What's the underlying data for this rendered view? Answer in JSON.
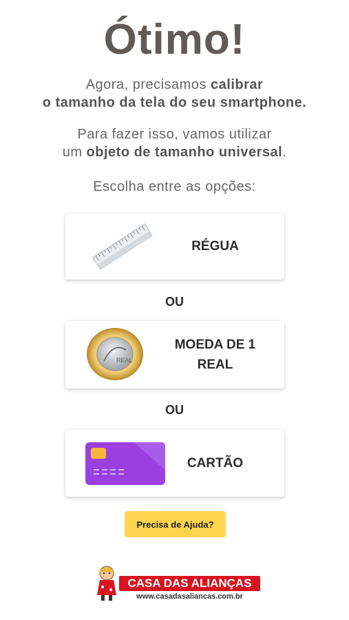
{
  "header": {
    "title": "Ótimo!"
  },
  "intro": {
    "line1_a": "Agora, precisamos ",
    "line1_b": "calibrar",
    "line2": "o tamanho da tela do seu smartphone."
  },
  "explain": {
    "line1": "Para fazer isso, vamos utilizar",
    "line2_a": "um ",
    "line2_b": "objeto de tamanho universal",
    "line2_c": "."
  },
  "prompt": "Escolha entre as opções:",
  "options": [
    {
      "label": "RÉGUA",
      "icon": "ruler-icon"
    },
    {
      "label_line1": "MOEDA DE 1",
      "label_line2": "REAL",
      "icon": "coin-icon"
    },
    {
      "label": "CARTÃO",
      "icon": "credit-card-icon"
    }
  ],
  "separator": "OU",
  "help_button": "Precisa de Ajuda?",
  "brand": {
    "name": "CASA DAS ALIANÇAS",
    "url": "www.casadasaliancas.com.br",
    "accent": "#d7141f"
  },
  "colors": {
    "help_bg": "#ffd54f",
    "card_purple": "#9c3fe0",
    "title": "#615b58"
  }
}
